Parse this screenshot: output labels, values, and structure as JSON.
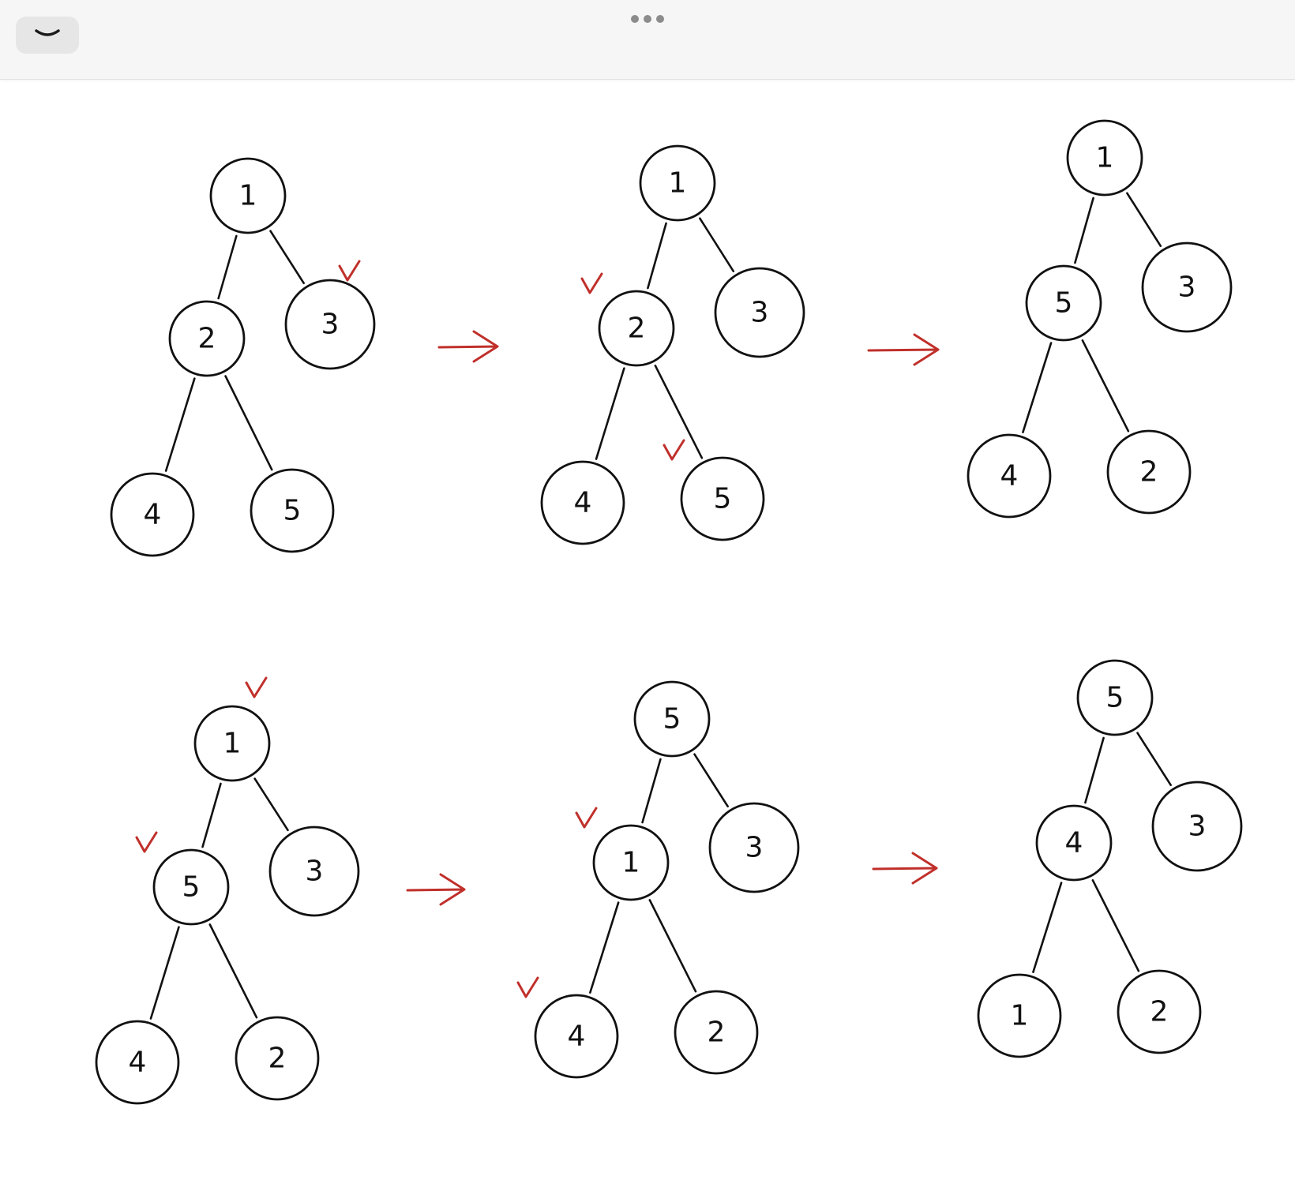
{
  "toolbar": {
    "collapse_icon": "chevron-down-icon",
    "more_icon": "more-horizontal-icon"
  },
  "colors": {
    "ink": "#111111",
    "annotation": "#c0302b",
    "toolbar_bg": "#f6f6f6"
  },
  "rows": [
    {
      "trees": [
        {
          "nodes": [
            "1",
            "2",
            "3",
            "4",
            "5"
          ],
          "marked": [
            2
          ]
        },
        {
          "nodes": [
            "1",
            "2",
            "3",
            "4",
            "5"
          ],
          "marked": [
            1,
            4
          ]
        },
        {
          "nodes": [
            "1",
            "5",
            "3",
            "4",
            "2"
          ],
          "marked": []
        }
      ],
      "arrows": 2
    },
    {
      "trees": [
        {
          "nodes": [
            "1",
            "5",
            "3",
            "4",
            "2"
          ],
          "marked": [
            0,
            1
          ]
        },
        {
          "nodes": [
            "5",
            "1",
            "3",
            "4",
            "2"
          ],
          "marked": [
            1,
            3
          ]
        },
        {
          "nodes": [
            "5",
            "4",
            "3",
            "1",
            "2"
          ],
          "marked": []
        }
      ],
      "arrows": 2
    }
  ]
}
